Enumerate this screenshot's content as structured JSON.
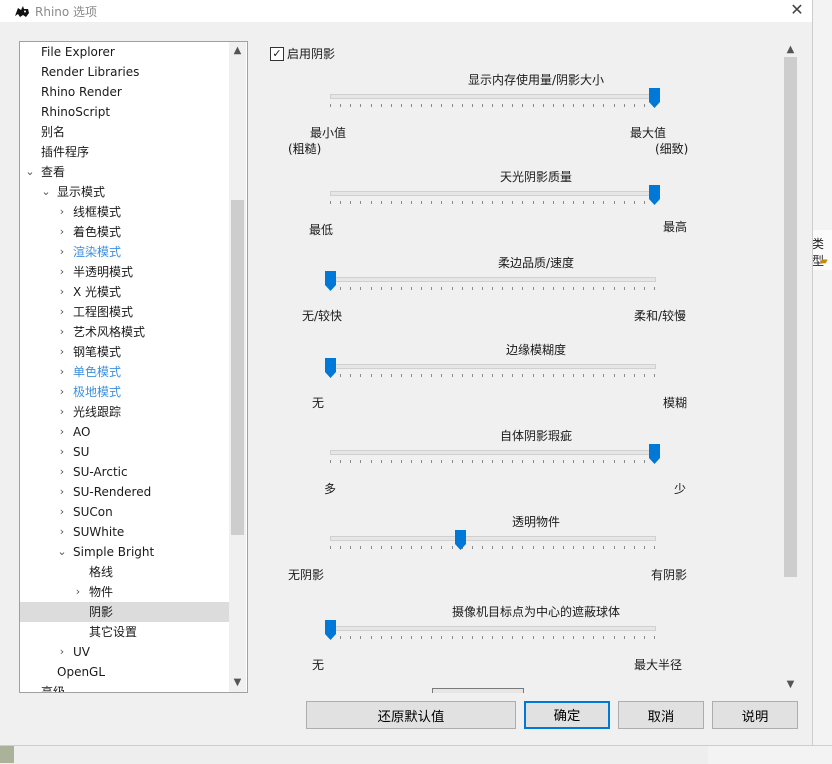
{
  "window": {
    "title": "Rhino 选项",
    "close_glyph": "✕"
  },
  "background": {
    "right_header": "类型"
  },
  "tree": {
    "items": [
      {
        "label": "File Explorer",
        "level": 1,
        "expander": "",
        "blue": false
      },
      {
        "label": "Render Libraries",
        "level": 1,
        "expander": "",
        "blue": false
      },
      {
        "label": "Rhino Render",
        "level": 1,
        "expander": "",
        "blue": false
      },
      {
        "label": "RhinoScript",
        "level": 1,
        "expander": "",
        "blue": false
      },
      {
        "label": "别名",
        "level": 1,
        "expander": "",
        "blue": false
      },
      {
        "label": "插件程序",
        "level": 1,
        "expander": "",
        "blue": false
      },
      {
        "label": "查看",
        "level": 1,
        "expander": "open",
        "blue": false
      },
      {
        "label": "显示模式",
        "level": 2,
        "expander": "open",
        "blue": false
      },
      {
        "label": "线框模式",
        "level": 3,
        "expander": "closed",
        "blue": false
      },
      {
        "label": "着色模式",
        "level": 3,
        "expander": "closed",
        "blue": false
      },
      {
        "label": "渲染模式",
        "level": 3,
        "expander": "closed",
        "blue": true
      },
      {
        "label": "半透明模式",
        "level": 3,
        "expander": "closed",
        "blue": false
      },
      {
        "label": "X 光模式",
        "level": 3,
        "expander": "closed",
        "blue": false
      },
      {
        "label": "工程图模式",
        "level": 3,
        "expander": "closed",
        "blue": false
      },
      {
        "label": "艺术风格模式",
        "level": 3,
        "expander": "closed",
        "blue": false
      },
      {
        "label": "钢笔模式",
        "level": 3,
        "expander": "closed",
        "blue": false
      },
      {
        "label": "单色模式",
        "level": 3,
        "expander": "closed",
        "blue": true
      },
      {
        "label": "极地模式",
        "level": 3,
        "expander": "closed",
        "blue": true
      },
      {
        "label": "光线跟踪",
        "level": 3,
        "expander": "closed",
        "blue": false
      },
      {
        "label": "AO",
        "level": 3,
        "expander": "closed",
        "blue": false
      },
      {
        "label": "SU",
        "level": 3,
        "expander": "closed",
        "blue": false
      },
      {
        "label": "SU-Arctic",
        "level": 3,
        "expander": "closed",
        "blue": false
      },
      {
        "label": "SU-Rendered",
        "level": 3,
        "expander": "closed",
        "blue": false
      },
      {
        "label": "SUCon",
        "level": 3,
        "expander": "closed",
        "blue": false
      },
      {
        "label": "SUWhite",
        "level": 3,
        "expander": "closed",
        "blue": false
      },
      {
        "label": "Simple Bright",
        "level": 3,
        "expander": "open",
        "blue": false
      },
      {
        "label": "格线",
        "level": 4,
        "expander": "",
        "blue": false
      },
      {
        "label": "物件",
        "level": 4,
        "expander": "closed",
        "blue": false
      },
      {
        "label": "阴影",
        "level": 4,
        "expander": "",
        "blue": false,
        "selected": true
      },
      {
        "label": "其它设置",
        "level": 4,
        "expander": "",
        "blue": false
      },
      {
        "label": "UV",
        "level": 3,
        "expander": "closed",
        "blue": false
      },
      {
        "label": "OpenGL",
        "level": 2,
        "expander": "",
        "blue": false
      },
      {
        "label": "高级",
        "level": 1,
        "expander": "",
        "blue": false
      }
    ]
  },
  "shadow": {
    "enable_label": "启用阴影",
    "enabled": true,
    "sliders": [
      {
        "title": "显示内存使用量/阴影大小",
        "min_label": "最小值",
        "min_sub": "(粗糙)",
        "max_label": "最大值",
        "max_sub": "(细致)",
        "value": 1.0
      },
      {
        "title": "天光阴影质量",
        "min_label": "最低",
        "min_sub": "",
        "max_label": "最高",
        "max_sub": "",
        "value": 1.0
      },
      {
        "title": "柔边品质/速度",
        "min_label": "无/较快",
        "min_sub": "",
        "max_label": "柔和/较慢",
        "max_sub": "",
        "value": 0.0
      },
      {
        "title": "边缘模糊度",
        "min_label": "无",
        "min_sub": "",
        "max_label": "模糊",
        "max_sub": "",
        "value": 0.0
      },
      {
        "title": "自体阴影瑕疵",
        "min_label": "多",
        "min_sub": "",
        "max_label": "少",
        "max_sub": "",
        "value": 1.0
      },
      {
        "title": "透明物件",
        "min_label": "无阴影",
        "min_sub": "",
        "max_label": "有阴影",
        "max_sub": "",
        "value": 0.4
      },
      {
        "title": "摄像机目标点为中心的遮蔽球体",
        "min_label": "无",
        "min_sub": "",
        "max_label": "最大半径",
        "max_sub": "",
        "value": 0.0
      }
    ]
  },
  "buttons": {
    "restore": "还原默认值",
    "ok": "确定",
    "cancel": "取消",
    "help": "说明"
  },
  "colors": {
    "accent": "#0078d7",
    "blue_text": "#3d8fe0"
  }
}
